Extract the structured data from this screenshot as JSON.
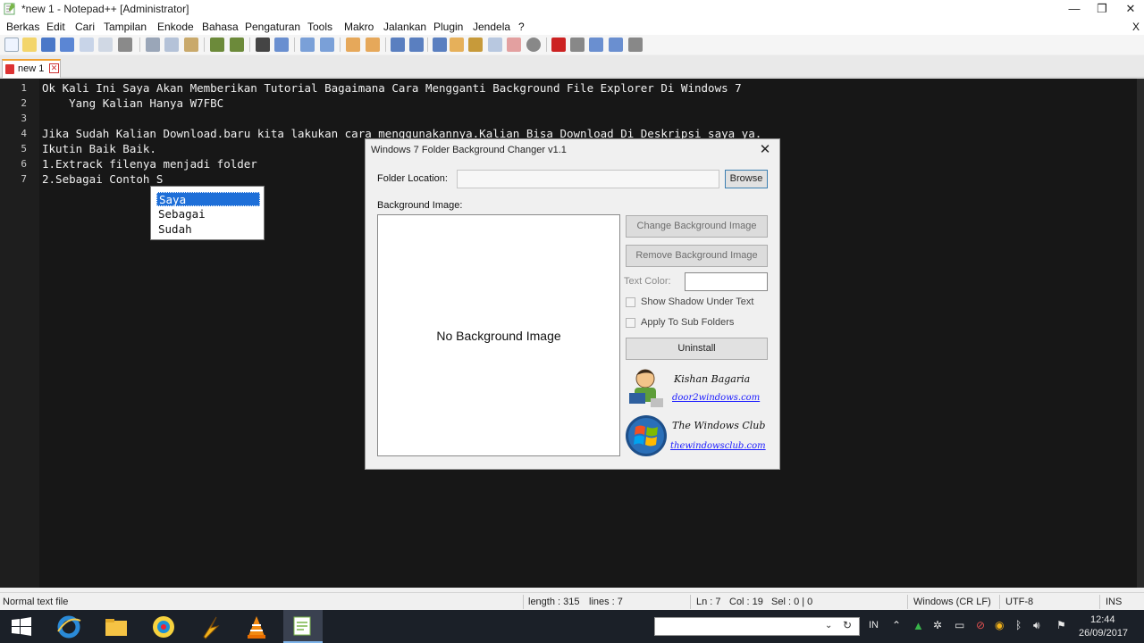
{
  "window": {
    "title": "*new 1 - Notepad++ [Administrator]",
    "minimize": "—",
    "maximize": "❐",
    "close": "✕",
    "doc_close": "X"
  },
  "menu": [
    "Berkas",
    "Edit",
    "Cari",
    "Tampilan",
    "Enkode",
    "Bahasa",
    "Pengaturan",
    "Tools",
    "Makro",
    "Jalankan",
    "Plugin",
    "Jendela",
    "?"
  ],
  "tab": {
    "label": "new 1",
    "close": "✕"
  },
  "editor": {
    "line_numbers": [
      "1",
      "2",
      "3",
      "4",
      "5",
      "6",
      "7"
    ],
    "lines": [
      "Ok Kali Ini Saya Akan Memberikan Tutorial Bagaimana Cara Mengganti Background File Explorer Di Windows 7",
      "    Yang Kalian Hanya W7FBC",
      "",
      "Jika Sudah Kalian Download.baru kita lakukan cara menggunakannya.Kalian Bisa Download Di Deskripsi saya ya.",
      "Ikutin Baik Baik.",
      "1.Extrack filenya menjadi folder",
      "2.Sebagai Contoh S"
    ]
  },
  "autocomplete": {
    "items": [
      "Saya",
      "Sebagai",
      "Sudah"
    ],
    "selected": "Saya"
  },
  "dialog": {
    "title": "Windows 7 Folder Background Changer v1.1",
    "close": "✕",
    "folder_label": "Folder Location:",
    "folder_value": "",
    "browse": "Browse",
    "bg_label": "Background Image:",
    "no_image": "No Background Image",
    "change_bg": "Change Background Image",
    "remove_bg": "Remove Background Image",
    "text_color": "Text Color:",
    "shadow": "Show Shadow Under Text",
    "subfolders": "Apply To Sub Folders",
    "uninstall": "Uninstall",
    "author1": "Kishan Bagaria",
    "link1": "door2windows.com",
    "author2": "The Windows Club",
    "link2": "thewindowsclub.com"
  },
  "status": {
    "type": "Normal text file",
    "length": "length : 315",
    "lines": "lines : 7",
    "ln": "Ln : 7",
    "col": "Col : 19",
    "sel": "Sel : 0 | 0",
    "eol": "Windows (CR LF)",
    "encoding": "UTF-8",
    "ins": "INS"
  },
  "taskbar": {
    "search_placeholder": "",
    "lang": "IN",
    "time": "12:44",
    "date": "26/09/2017"
  },
  "colors": {
    "editor_bg": "#171717",
    "selection": "#1e6fd8",
    "taskbar": "#1b2028"
  }
}
